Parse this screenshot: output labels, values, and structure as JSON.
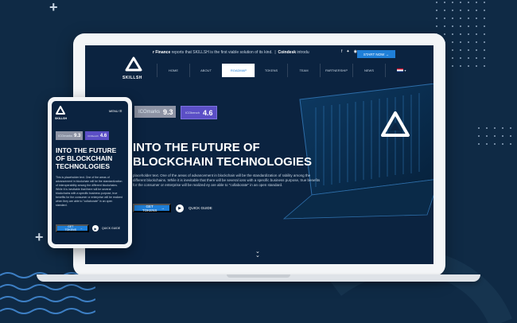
{
  "colors": {
    "background": "#0f2a45",
    "screen": "#0b2340",
    "accent": "#1f7fd8",
    "icobench": "#5b4fc6",
    "icomarks": "#8d93a4"
  },
  "header": {
    "ticker_prefix": "r Finance",
    "ticker_text": "reports that SKILLSH is the first viable solution of its kind.",
    "ticker_source": "Coindesk",
    "ticker_suffix": "introdu",
    "start_button": "START NOW",
    "language": "EN"
  },
  "brand": {
    "name": "SKILLSH"
  },
  "nav": {
    "items": [
      "HOME",
      "ABOUT",
      "ROADMAP",
      "TOKENS",
      "TEAM",
      "PARTNERSHIP",
      "NEWS"
    ]
  },
  "ratings": {
    "icomarks": {
      "label": "ICOmarks",
      "score": "9.3"
    },
    "icobench": {
      "label": "ICObench",
      "score": "4.6"
    }
  },
  "hero": {
    "title": "INTO THE FUTURE OF BLOCKCHAIN TECHNOLOGIES",
    "desktop_text": "placeholder text. One of the areas of advancement in blockchain will be the standardization of rability among the different blockchains. While it is inevitable that there will be several ions with a specific business purpose, true benefits for the consumer or enterprise will be realized ey are able to \"collaborate\" in an open standard.",
    "phone_text": "This is placeholder text. One of the areas of advancement in blockchain will be the standardization of interoperability among the different blockchains. While it is inevitable that there will be several blockchains with a specific business purpose, true benefits for the consumer or enterprise will be realized when they are able to \"collaborate\" in an open standard.",
    "tokens_button": "GET TOKENS",
    "guide_label": "QUICK GUIDE"
  },
  "phone": {
    "menu_label": "MENU"
  },
  "icons": [
    "logo-icon",
    "facebook-icon",
    "twitter-icon",
    "instagram-icon",
    "telegram-icon",
    "play-icon",
    "chevron-down-icon",
    "menu-icon",
    "flag-icon"
  ]
}
